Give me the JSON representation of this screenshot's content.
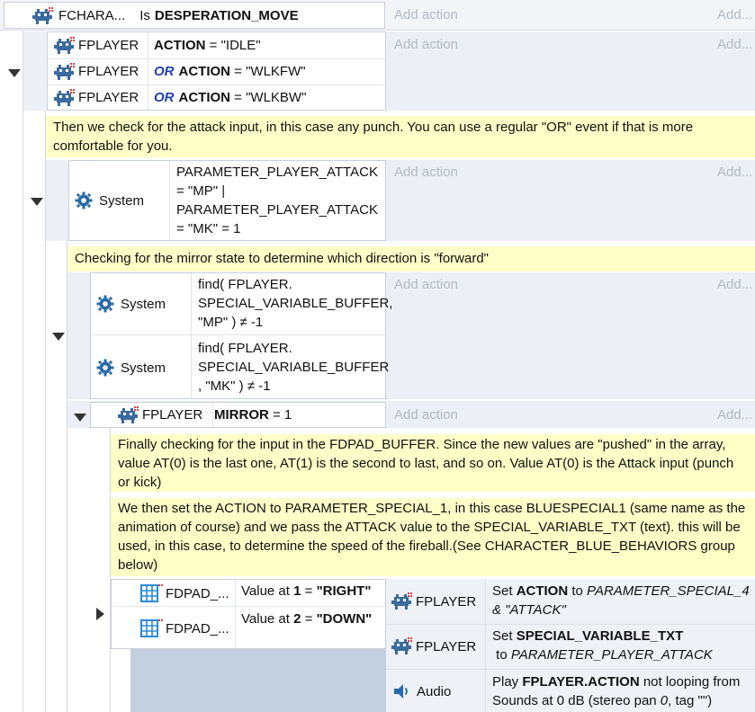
{
  "row0": {
    "object": "FCHARA...",
    "prefix": "Is",
    "condition": "DESPERATION_MOVE",
    "add_action": "Add action",
    "add_right": "Add..."
  },
  "block1": {
    "conds": [
      {
        "object": "FPLAYER",
        "or": "",
        "field": "ACTION",
        "rest": " = \"IDLE\""
      },
      {
        "object": "FPLAYER",
        "or": "OR",
        "field": "ACTION",
        "rest": " = \"WLKFW\""
      },
      {
        "object": "FPLAYER",
        "or": "OR",
        "field": "ACTION",
        "rest": " = \"WLKBW\""
      }
    ],
    "add_action": "Add action",
    "add_right": "Add..."
  },
  "comment1": "Then we check for the attack input, in this case any punch. You can use a regular \"OR\" event if that is more comfortable for you.",
  "block2": {
    "object": "System",
    "expr": "PARAMETER_PLAYER_ATTACK = \"MP\" | PARAMETER_PLAYER_ATTACK = \"MK\"  = 1",
    "add_action": "Add action",
    "add_right": "Add..."
  },
  "comment2": "Checking for the mirror state to determine which direction is \"forward\"",
  "block3": {
    "conds": [
      {
        "object": "System",
        "expr": "find( FPLAYER. SPECIAL_VARIABLE_BUFFER, \"MP\" ) ≠ -1"
      },
      {
        "object": "System",
        "expr": "find( FPLAYER. SPECIAL_VARIABLE_BUFFER , \"MK\" ) ≠ -1"
      }
    ],
    "add_action": "Add action",
    "add_right": "Add..."
  },
  "block4": {
    "object": "FPLAYER",
    "field": "MIRROR",
    "rest": " = 1",
    "add_action": "Add action",
    "add_right": "Add..."
  },
  "comment3": "Finally checking for the input in the FDPAD_BUFFER. Since the new values are \"pushed\" in the array, value AT(0) is the last one, AT(1) is the second to last, and so on.  Value AT(0) is the Attack input (punch or kick)",
  "comment4": "We then set the ACTION to PARAMETER_SPECIAL_1, in this case BLUESPECIAL1 (same name as the animation of course) and we pass the ATTACK value to the SPECIAL_VARIABLE_TXT  (text). this will be used, in this case, to determine the speed of the fireball.(See CHARACTER_BLUE_BEHAVIORS group below)",
  "block5": {
    "conds": [
      {
        "object": "FDPAD_...",
        "prefix": "Value at ",
        "index": "1",
        "eq": " = ",
        "value": "\"RIGHT\""
      },
      {
        "object": "FDPAD_...",
        "prefix": "Value at ",
        "index": "2",
        "eq": " = ",
        "value": "\"DOWN\""
      }
    ],
    "actions": [
      {
        "object": "FPLAYER",
        "pre": "Set ",
        "field": "ACTION",
        "mid": " to ",
        "value": "PARAMETER_SPECIAL_4 & \"ATTACK\""
      },
      {
        "object": "FPLAYER",
        "pre": "Set ",
        "field": "SPECIAL_VARIABLE_TXT",
        "mid": " to ",
        "value": "PARAMETER_PLAYER_ATTACK"
      },
      {
        "object": "Audio",
        "pre": "Play ",
        "field": "FPLAYER.ACTION",
        "mid": " not looping from Sounds at 0 dB (stereo pan ",
        "value": "0",
        "tail": ", tag \"\")"
      }
    ]
  },
  "icons": {
    "sprite": "sprite-object-icon",
    "gear": "gear-icon",
    "array": "array-grid-icon",
    "audio": "speaker-icon"
  },
  "colors": {
    "comment_bg": "#ffffc8",
    "panel_bg": "#eceff5",
    "or_keyword": "#1f3fb0",
    "icon_blue": "#2a6aa8",
    "array_blue": "#2b8ad8",
    "placeholder": "#b3b9c4"
  }
}
